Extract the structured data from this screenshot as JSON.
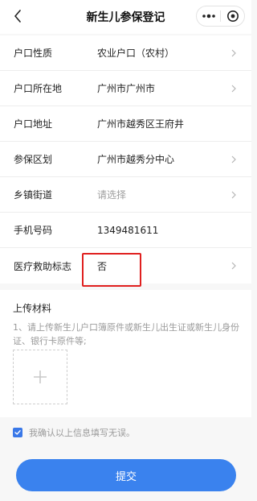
{
  "navbar": {
    "title": "新生儿参保登记",
    "back_icon": "chevron-left-icon",
    "more_icon": "more-dots-icon",
    "close_icon": "target-circle-icon"
  },
  "form": {
    "rows": [
      {
        "label": "户口性质",
        "value": "农业户口（农村）",
        "has_arrow": true,
        "placeholder": false
      },
      {
        "label": "户口所在地",
        "value": "广州市广州市",
        "has_arrow": true,
        "placeholder": false
      },
      {
        "label": "户口地址",
        "value": "广州市越秀区王府井",
        "has_arrow": false,
        "placeholder": false
      },
      {
        "label": "参保区划",
        "value": "广州市越秀分中心",
        "has_arrow": true,
        "placeholder": false
      },
      {
        "label": "乡镇街道",
        "value": "请选择",
        "has_arrow": true,
        "placeholder": true
      },
      {
        "label": "手机号码",
        "value": "1349481611",
        "has_arrow": false,
        "placeholder": false
      },
      {
        "label": "医疗救助标志",
        "value": "否",
        "has_arrow": true,
        "placeholder": false
      }
    ]
  },
  "upload": {
    "title": "上传材料",
    "description": "1、请上传新生儿户口簿原件或新生儿出生证或新生儿身份证、银行卡原件等;",
    "add_icon": "plus-icon"
  },
  "confirm": {
    "checked": true,
    "text": "我确认以上信息填写无误。"
  },
  "submit": {
    "label": "提交"
  },
  "colors": {
    "accent": "#3a82ee",
    "highlight": "#e0201f",
    "placeholder": "#9e9e9e"
  }
}
